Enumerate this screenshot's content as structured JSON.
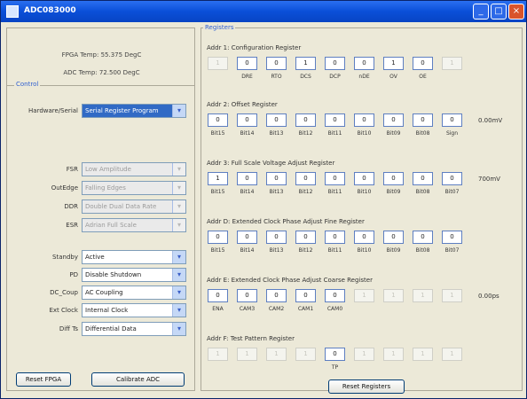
{
  "window": {
    "title": "ADC083000"
  },
  "temps": {
    "fpga": "FPGA Temp: 55.375 DegC",
    "adc": "ADC Temp: 72.500 DegC"
  },
  "control": {
    "title": "Control",
    "rows": [
      {
        "label": "Hardware/Serial",
        "value": "Serial Register Program",
        "enabled": true,
        "selected": true
      },
      {
        "label": "FSR",
        "value": "Low Amplitude",
        "enabled": false
      },
      {
        "label": "OutEdge",
        "value": "Falling Edges",
        "enabled": false
      },
      {
        "label": "DDR",
        "value": "Double Dual Data Rate",
        "enabled": false
      },
      {
        "label": "ESR",
        "value": "Adrian Full Scale",
        "enabled": false
      },
      {
        "label": "Standby",
        "value": "Active",
        "enabled": true
      },
      {
        "label": "PD",
        "value": "Disable Shutdown",
        "enabled": true
      },
      {
        "label": "DC_Coup",
        "value": "AC Coupling",
        "enabled": true
      },
      {
        "label": "Ext Clock",
        "value": "Internal Clock",
        "enabled": true
      },
      {
        "label": "Diff Ts",
        "value": "Differential Data",
        "enabled": true
      }
    ],
    "reset_fpga": "Reset FPGA",
    "calibrate_adc": "Calibrate ADC"
  },
  "registers": {
    "title": "Registers",
    "groups": [
      {
        "title": "Addr 1: Configuration Register",
        "cells": [
          "1",
          "0",
          "0",
          "1",
          "0",
          "0",
          "1",
          "0",
          "1"
        ],
        "active": [
          false,
          true,
          true,
          true,
          true,
          true,
          true,
          true,
          false
        ],
        "labels": [
          "",
          "DRE",
          "RTO",
          "DCS",
          "DCP",
          "nDE",
          "OV",
          "OE",
          ""
        ],
        "unit": ""
      },
      {
        "title": "Addr 2: Offset Register",
        "cells": [
          "0",
          "0",
          "0",
          "0",
          "0",
          "0",
          "0",
          "0",
          "0"
        ],
        "active": [
          true,
          true,
          true,
          true,
          true,
          true,
          true,
          true,
          true
        ],
        "labels": [
          "Bit15",
          "Bit14",
          "Bit13",
          "Bit12",
          "Bit11",
          "Bit10",
          "Bit09",
          "Bit08",
          "Sign"
        ],
        "unit": "0.00mV"
      },
      {
        "title": "Addr 3: Full Scale Voltage Adjust Register",
        "cells": [
          "1",
          "0",
          "0",
          "0",
          "0",
          "0",
          "0",
          "0",
          "0"
        ],
        "active": [
          true,
          true,
          true,
          true,
          true,
          true,
          true,
          true,
          true
        ],
        "labels": [
          "Bit15",
          "Bit14",
          "Bit13",
          "Bit12",
          "Bit11",
          "Bit10",
          "Bit09",
          "Bit08",
          "Bit07"
        ],
        "unit": "700mV"
      },
      {
        "title": "Addr D: Extended Clock Phase Adjust Fine Register",
        "cells": [
          "0",
          "0",
          "0",
          "0",
          "0",
          "0",
          "0",
          "0",
          "0"
        ],
        "active": [
          true,
          true,
          true,
          true,
          true,
          true,
          true,
          true,
          true
        ],
        "labels": [
          "Bit15",
          "Bit14",
          "Bit13",
          "Bit12",
          "Bit11",
          "Bit10",
          "Bit09",
          "Bit08",
          "Bit07"
        ],
        "unit": ""
      },
      {
        "title": "Addr E: Extended Clock Phase Adjust Coarse Register",
        "cells": [
          "0",
          "0",
          "0",
          "0",
          "0",
          "1",
          "1",
          "1",
          "1"
        ],
        "active": [
          true,
          true,
          true,
          true,
          true,
          false,
          false,
          false,
          false
        ],
        "labels": [
          "ENA",
          "CAM3",
          "CAM2",
          "CAM1",
          "CAM0",
          "",
          "",
          "",
          ""
        ],
        "unit": "0.00ps"
      },
      {
        "title": "Addr F: Test Pattern Register",
        "cells": [
          "1",
          "1",
          "1",
          "1",
          "0",
          "1",
          "1",
          "1",
          "1"
        ],
        "active": [
          false,
          false,
          false,
          false,
          true,
          false,
          false,
          false,
          false
        ],
        "labels": [
          "",
          "",
          "",
          "",
          "TP",
          "",
          "",
          "",
          ""
        ],
        "unit": ""
      }
    ],
    "reset_registers": "Reset Registers"
  }
}
